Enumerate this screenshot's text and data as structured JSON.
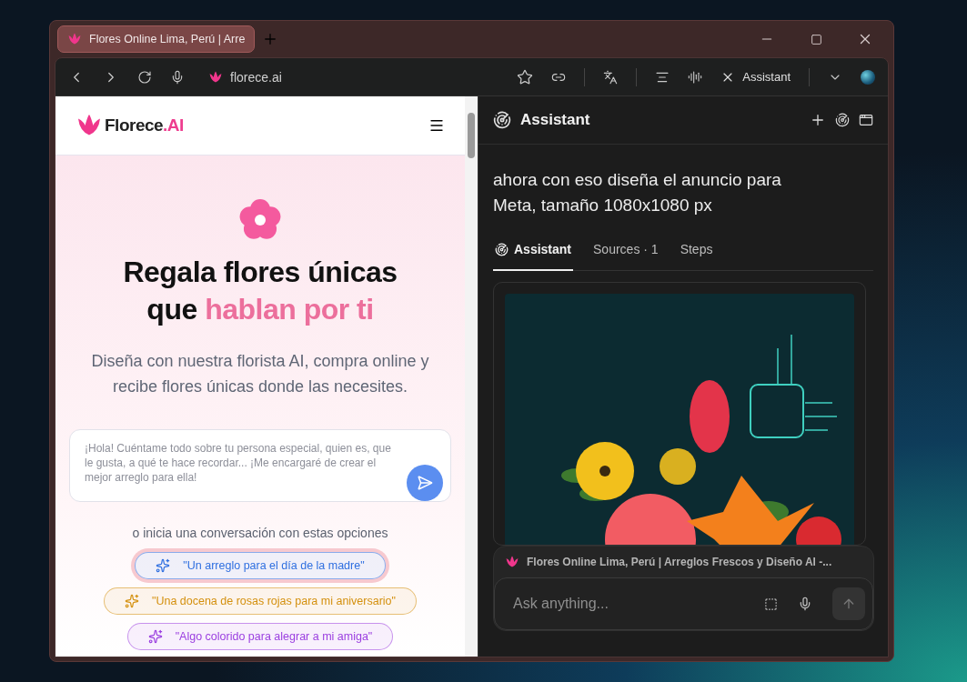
{
  "browser": {
    "tabs": [
      {
        "title": "Flores Online Lima, Perú | Arre",
        "selected": true
      }
    ],
    "address": "florece.ai",
    "assistant_button": "Assistant"
  },
  "page": {
    "logo": {
      "name": "Florece",
      "suffix": ".AI"
    },
    "hero": {
      "line_1": "Regala flores únicas",
      "line_2_plain": "que ",
      "line_2_highlight": "hablan por ti"
    },
    "subtitle": "Diseña con nuestra florista AI, compra online y recibe flores únicas donde las necesites.",
    "chat_input": {
      "placeholder": "¡Hola! Cuéntame todo sobre tu persona especial, quien es, que le gusta, a qué te hace recordar... ¡Me encargaré de crear el mejor arreglo para ella!"
    },
    "options_label": "o inicia una conversación con estas opciones",
    "suggestions": [
      {
        "text": "\"Un arreglo para el día de la madre\"",
        "color": "#2f6fe0",
        "selected": true
      },
      {
        "text": "\"Una docena de rosas rojas para mi aniversario\"",
        "color": "#d4900e",
        "selected": false
      },
      {
        "text": "\"Algo colorido para alegrar a mi amiga\"",
        "color": "#9b3fe0",
        "selected": false
      }
    ]
  },
  "assistant": {
    "title": "Assistant",
    "query": "ahora con eso diseña el anuncio para Meta, tamaño 1080x1080 px",
    "tabs": [
      {
        "label": "Assistant",
        "selected": true
      },
      {
        "label": "Sources · 1",
        "selected": false
      },
      {
        "label": "Steps",
        "selected": false
      }
    ],
    "context": "Flores Online Lima, Perú | Arreglos Frescos y Diseño AI -...",
    "input": {
      "placeholder": "Ask anything..."
    }
  }
}
